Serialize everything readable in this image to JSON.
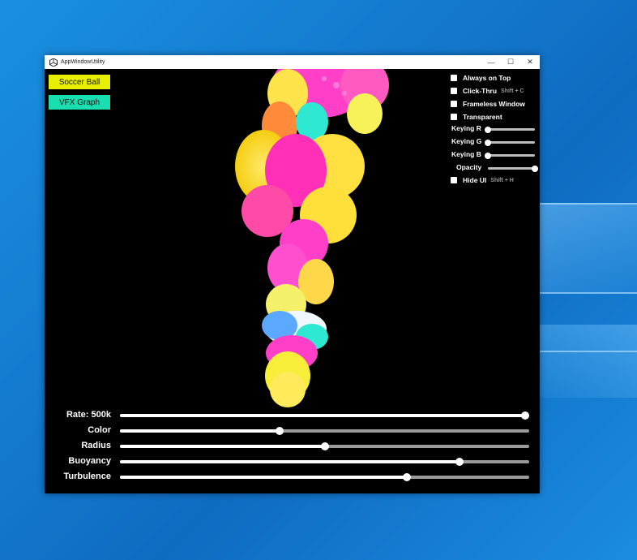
{
  "window": {
    "title": "AppWindowUtility",
    "minimize": "—",
    "maximize": "☐",
    "close": "✕"
  },
  "scene_buttons": {
    "soccer": "Soccer Ball",
    "vfx": "VFX Graph"
  },
  "options": {
    "always_on_top": "Always on Top",
    "click_thru": "Click-Thru",
    "click_thru_hint": "Shift + C",
    "frameless": "Frameless Window",
    "transparent": "Transparent",
    "keying_r": "Keying R",
    "keying_g": "Keying G",
    "keying_b": "Keying B",
    "opacity": "Opacity",
    "hide_ui": "Hide UI",
    "hide_ui_hint": "Shift + H"
  },
  "option_values": {
    "keying_r": 0,
    "keying_g": 0,
    "keying_b": 0,
    "opacity": 1.0
  },
  "sliders": [
    {
      "label": "Rate: 500k",
      "value": 1.0
    },
    {
      "label": "Color",
      "value": 0.39
    },
    {
      "label": "Radius",
      "value": 0.5
    },
    {
      "label": "Buoyancy",
      "value": 0.83
    },
    {
      "label": "Turbulence",
      "value": 0.7
    }
  ]
}
